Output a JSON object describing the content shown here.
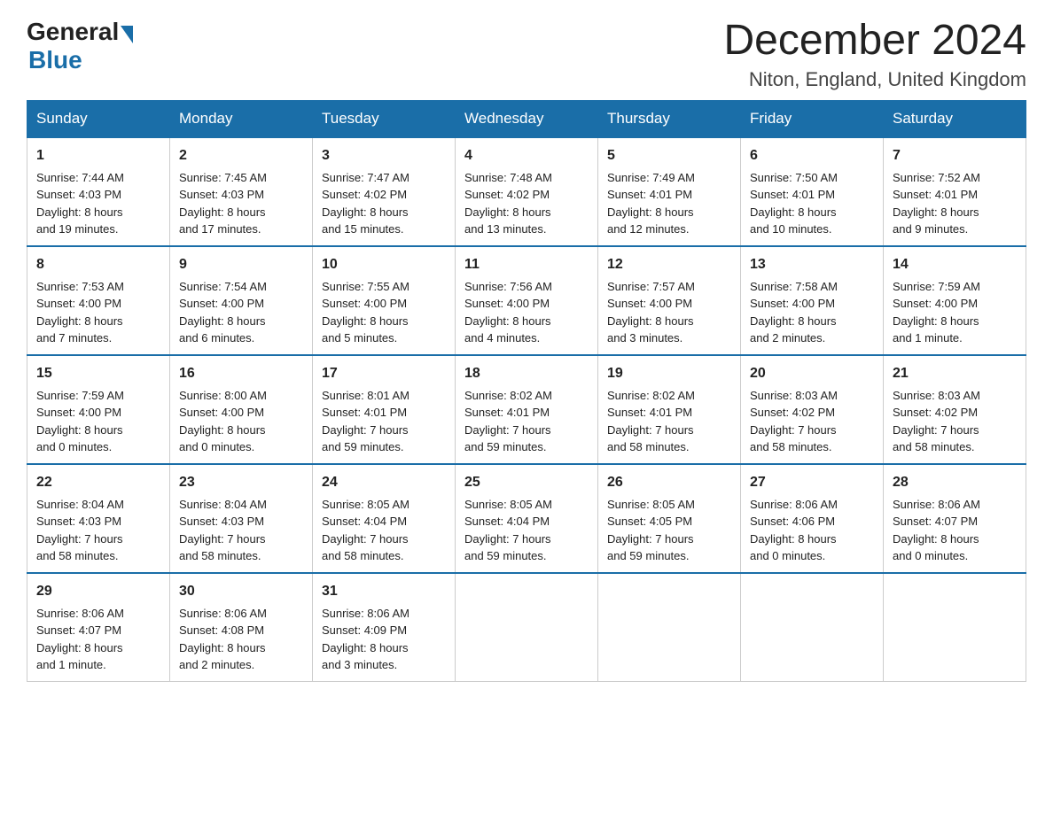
{
  "header": {
    "logo": {
      "general": "General",
      "blue": "Blue"
    },
    "title": "December 2024",
    "location": "Niton, England, United Kingdom"
  },
  "weekdays": [
    "Sunday",
    "Monday",
    "Tuesday",
    "Wednesday",
    "Thursday",
    "Friday",
    "Saturday"
  ],
  "weeks": [
    [
      {
        "day": "1",
        "sunrise": "7:44 AM",
        "sunset": "4:03 PM",
        "daylight": "8 hours and 19 minutes."
      },
      {
        "day": "2",
        "sunrise": "7:45 AM",
        "sunset": "4:03 PM",
        "daylight": "8 hours and 17 minutes."
      },
      {
        "day": "3",
        "sunrise": "7:47 AM",
        "sunset": "4:02 PM",
        "daylight": "8 hours and 15 minutes."
      },
      {
        "day": "4",
        "sunrise": "7:48 AM",
        "sunset": "4:02 PM",
        "daylight": "8 hours and 13 minutes."
      },
      {
        "day": "5",
        "sunrise": "7:49 AM",
        "sunset": "4:01 PM",
        "daylight": "8 hours and 12 minutes."
      },
      {
        "day": "6",
        "sunrise": "7:50 AM",
        "sunset": "4:01 PM",
        "daylight": "8 hours and 10 minutes."
      },
      {
        "day": "7",
        "sunrise": "7:52 AM",
        "sunset": "4:01 PM",
        "daylight": "8 hours and 9 minutes."
      }
    ],
    [
      {
        "day": "8",
        "sunrise": "7:53 AM",
        "sunset": "4:00 PM",
        "daylight": "8 hours and 7 minutes."
      },
      {
        "day": "9",
        "sunrise": "7:54 AM",
        "sunset": "4:00 PM",
        "daylight": "8 hours and 6 minutes."
      },
      {
        "day": "10",
        "sunrise": "7:55 AM",
        "sunset": "4:00 PM",
        "daylight": "8 hours and 5 minutes."
      },
      {
        "day": "11",
        "sunrise": "7:56 AM",
        "sunset": "4:00 PM",
        "daylight": "8 hours and 4 minutes."
      },
      {
        "day": "12",
        "sunrise": "7:57 AM",
        "sunset": "4:00 PM",
        "daylight": "8 hours and 3 minutes."
      },
      {
        "day": "13",
        "sunrise": "7:58 AM",
        "sunset": "4:00 PM",
        "daylight": "8 hours and 2 minutes."
      },
      {
        "day": "14",
        "sunrise": "7:59 AM",
        "sunset": "4:00 PM",
        "daylight": "8 hours and 1 minute."
      }
    ],
    [
      {
        "day": "15",
        "sunrise": "7:59 AM",
        "sunset": "4:00 PM",
        "daylight": "8 hours and 0 minutes."
      },
      {
        "day": "16",
        "sunrise": "8:00 AM",
        "sunset": "4:00 PM",
        "daylight": "8 hours and 0 minutes."
      },
      {
        "day": "17",
        "sunrise": "8:01 AM",
        "sunset": "4:01 PM",
        "daylight": "7 hours and 59 minutes."
      },
      {
        "day": "18",
        "sunrise": "8:02 AM",
        "sunset": "4:01 PM",
        "daylight": "7 hours and 59 minutes."
      },
      {
        "day": "19",
        "sunrise": "8:02 AM",
        "sunset": "4:01 PM",
        "daylight": "7 hours and 58 minutes."
      },
      {
        "day": "20",
        "sunrise": "8:03 AM",
        "sunset": "4:02 PM",
        "daylight": "7 hours and 58 minutes."
      },
      {
        "day": "21",
        "sunrise": "8:03 AM",
        "sunset": "4:02 PM",
        "daylight": "7 hours and 58 minutes."
      }
    ],
    [
      {
        "day": "22",
        "sunrise": "8:04 AM",
        "sunset": "4:03 PM",
        "daylight": "7 hours and 58 minutes."
      },
      {
        "day": "23",
        "sunrise": "8:04 AM",
        "sunset": "4:03 PM",
        "daylight": "7 hours and 58 minutes."
      },
      {
        "day": "24",
        "sunrise": "8:05 AM",
        "sunset": "4:04 PM",
        "daylight": "7 hours and 58 minutes."
      },
      {
        "day": "25",
        "sunrise": "8:05 AM",
        "sunset": "4:04 PM",
        "daylight": "7 hours and 59 minutes."
      },
      {
        "day": "26",
        "sunrise": "8:05 AM",
        "sunset": "4:05 PM",
        "daylight": "7 hours and 59 minutes."
      },
      {
        "day": "27",
        "sunrise": "8:06 AM",
        "sunset": "4:06 PM",
        "daylight": "8 hours and 0 minutes."
      },
      {
        "day": "28",
        "sunrise": "8:06 AM",
        "sunset": "4:07 PM",
        "daylight": "8 hours and 0 minutes."
      }
    ],
    [
      {
        "day": "29",
        "sunrise": "8:06 AM",
        "sunset": "4:07 PM",
        "daylight": "8 hours and 1 minute."
      },
      {
        "day": "30",
        "sunrise": "8:06 AM",
        "sunset": "4:08 PM",
        "daylight": "8 hours and 2 minutes."
      },
      {
        "day": "31",
        "sunrise": "8:06 AM",
        "sunset": "4:09 PM",
        "daylight": "8 hours and 3 minutes."
      },
      null,
      null,
      null,
      null
    ]
  ],
  "labels": {
    "sunrise": "Sunrise:",
    "sunset": "Sunset:",
    "daylight": "Daylight:"
  }
}
